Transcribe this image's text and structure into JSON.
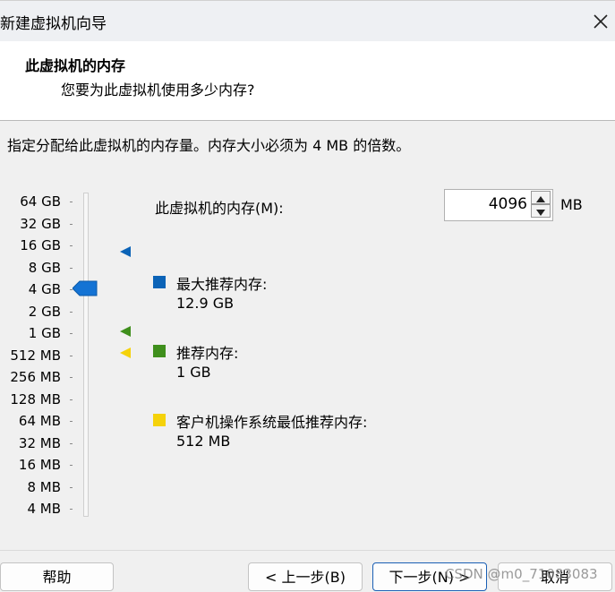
{
  "window": {
    "title": "新建虚拟机向导",
    "close_icon": "close-icon"
  },
  "header": {
    "title": "此虚拟机的内存",
    "subtitle": "您要为此虚拟机使用多少内存?"
  },
  "instruction": "指定分配给此虚拟机的内存量。内存大小必须为 4 MB 的倍数。",
  "memory": {
    "label": "此虚拟机的内存(M):",
    "value": "4096",
    "unit": "MB"
  },
  "scale": {
    "labels": [
      "64 GB",
      "32 GB",
      "16 GB",
      "8 GB",
      "4 GB",
      "2 GB",
      "1 GB",
      "512 MB",
      "256 MB",
      "128 MB",
      "64 MB",
      "32 MB",
      "16 MB",
      "8 MB",
      "4 MB"
    ],
    "selected": "4 GB"
  },
  "legend": {
    "max": {
      "title": "最大推荐内存:",
      "value": "12.9 GB",
      "color": "#0b63b7"
    },
    "recommended": {
      "title": "推荐内存:",
      "value": "1 GB",
      "color": "#3f8f1c"
    },
    "min": {
      "title": "客户机操作系统最低推荐内存:",
      "value": "512 MB",
      "color": "#f5d20a"
    }
  },
  "footer": {
    "help": "帮助",
    "back": "< 上一步(B)",
    "next": "下一步(N) >",
    "cancel": "取消"
  },
  "watermark": "CSDN @m0_71083083"
}
